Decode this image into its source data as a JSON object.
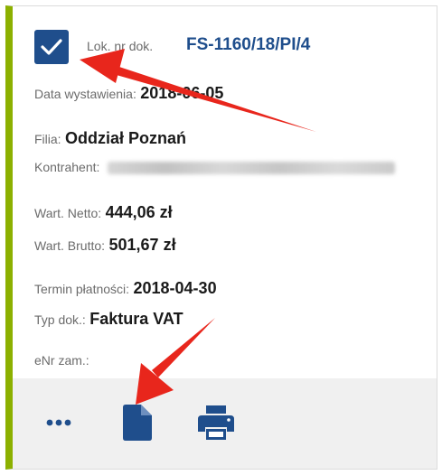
{
  "document": {
    "number_label": "Lok. nr dok.",
    "number": "FS-1160/18/PI/4",
    "issue_date_label": "Data wystawienia:",
    "issue_date": "2018-06-05",
    "branch_label": "Filia:",
    "branch": "Oddział Poznań",
    "contractor_label": "Kontrahent:",
    "net_label": "Wart. Netto:",
    "net_value": "444,06 zł",
    "gross_label": "Wart. Brutto:",
    "gross_value": "501,67 zł",
    "due_label": "Termin płatności:",
    "due_date": "2018-04-30",
    "type_label": "Typ dok.:",
    "type": "Faktura VAT",
    "order_label": "eNr zam.:"
  },
  "footer": {
    "more_icon": "more-horizontal-icon",
    "document_icon": "document-icon",
    "print_icon": "printer-icon"
  },
  "colors": {
    "accent": "#1f4e8c",
    "status_bar": "#8cb000",
    "annotation_arrow": "#e8261c"
  }
}
